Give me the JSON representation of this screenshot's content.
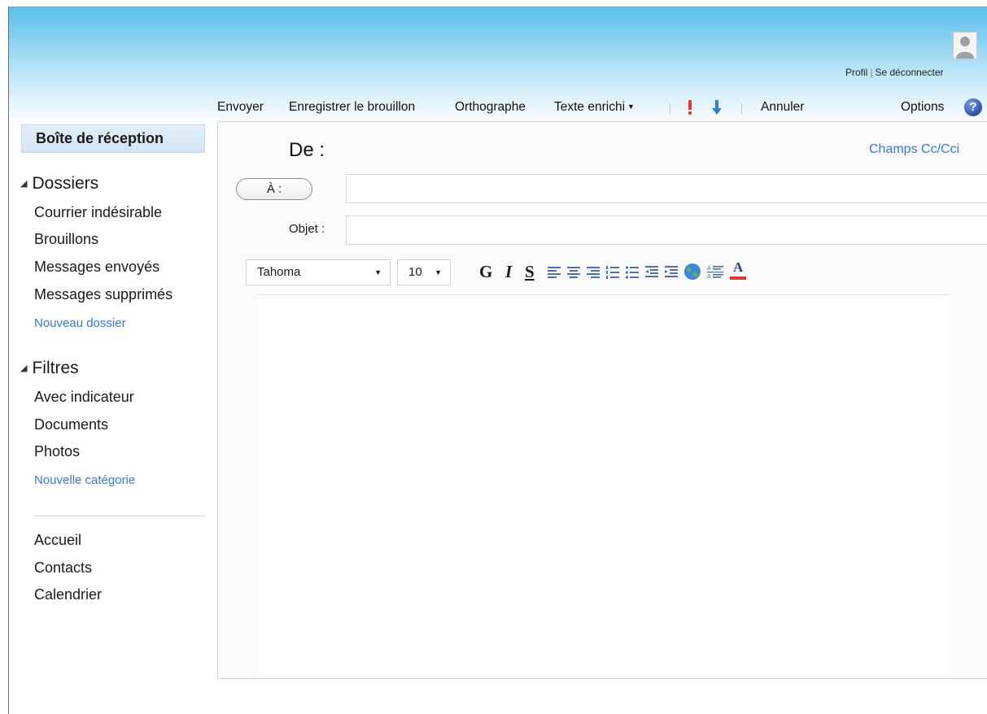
{
  "header": {
    "profile_label": "Profil",
    "logout_label": "Se déconnecter"
  },
  "toolbar": {
    "send": "Envoyer",
    "save_draft": "Enregistrer le brouillon",
    "spelling": "Orthographe",
    "rich_text": "Texte enrichi",
    "cancel": "Annuler",
    "options": "Options",
    "help": "?"
  },
  "sidebar": {
    "inbox": "Boîte de réception",
    "folders_title": "Dossiers",
    "folders": [
      "Courrier indésirable",
      "Brouillons",
      "Messages envoyés",
      "Messages supprimés"
    ],
    "new_folder": "Nouveau dossier",
    "filters_title": "Filtres",
    "filters": [
      "Avec indicateur",
      "Documents",
      "Photos"
    ],
    "new_category": "Nouvelle catégorie",
    "nav": [
      "Accueil",
      "Contacts",
      "Calendrier"
    ]
  },
  "compose": {
    "from_label": "De :",
    "cc_link": "Champs Cc/Cci",
    "to_label": "À :",
    "to_value": "",
    "subject_label": "Objet :",
    "subject_value": "",
    "font_name": "Tahoma",
    "font_size": "10",
    "bold": "G",
    "italic": "I",
    "underline": "S",
    "text_color_glyph": "A"
  },
  "icons": {
    "priority_high": "red-exclamation-icon",
    "priority_low": "blue-down-arrow-icon",
    "help": "help-question-icon",
    "globe": "globe-icon"
  },
  "colors": {
    "accent_link": "#3a79c6",
    "priority_high": "#e5362b",
    "priority_low": "#2f7fd1",
    "text_color_underline": "#e5362b"
  }
}
